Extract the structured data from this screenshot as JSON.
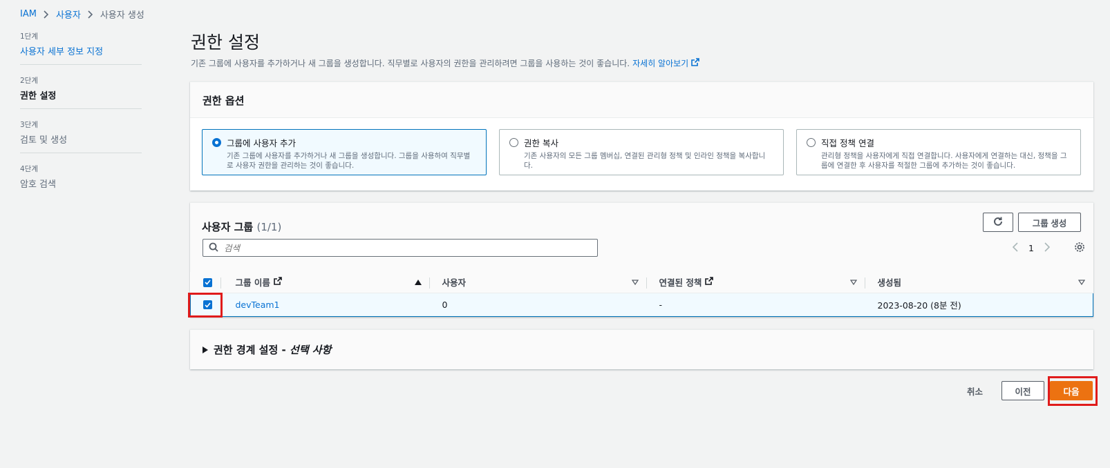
{
  "breadcrumb": [
    "IAM",
    "사용자",
    "사용자 생성"
  ],
  "steps": [
    {
      "num": "1단계",
      "title": "사용자 세부 정보 지정"
    },
    {
      "num": "2단계",
      "title": "권한 설정"
    },
    {
      "num": "3단계",
      "title": "검토 및 생성"
    },
    {
      "num": "4단계",
      "title": "암호 검색"
    }
  ],
  "page": {
    "title": "권한 설정",
    "description": "기존 그룹에 사용자를 추가하거나 새 그룹을 생성합니다. 직무별로 사용자의 권한을 관리하려면 그룹을 사용하는 것이 좋습니다.",
    "learn_more": "자세히 알아보기"
  },
  "options": {
    "header": "권한 옵션",
    "tiles": [
      {
        "title": "그룹에 사용자 추가",
        "desc": "기존 그룹에 사용자를 추가하거나 새 그룹을 생성합니다. 그룹을 사용하여 직무별로 사용자 권한을 관리하는 것이 좋습니다."
      },
      {
        "title": "권한 복사",
        "desc": "기존 사용자의 모든 그룹 멤버십, 연결된 관리형 정책 및 인라인 정책을 복사합니다."
      },
      {
        "title": "직접 정책 연결",
        "desc": "관리형 정책을 사용자에게 직접 연결합니다. 사용자에게 연결하는 대신, 정책을 그룹에 연결한 후 사용자를 적절한 그룹에 추가하는 것이 좋습니다."
      }
    ]
  },
  "groups": {
    "title": "사용자 그룹",
    "count": "(1/1)",
    "create_label": "그룹 생성",
    "search_placeholder": "검색",
    "page_number": "1",
    "columns": [
      "그룹 이름",
      "사용자",
      "연결된 정책",
      "생성됨"
    ],
    "rows": [
      {
        "name": "devTeam1",
        "users": "0",
        "policies": "-",
        "created": "2023-08-20 (8분 전)"
      }
    ]
  },
  "boundary": {
    "title": "권한 경계 설정 - ",
    "optional": "선택 사항"
  },
  "actions": {
    "cancel": "취소",
    "previous": "이전",
    "next": "다음"
  },
  "colors": {
    "accent": "#0972d3",
    "primary_button": "#ec7211",
    "highlight": "#e01b1b"
  }
}
